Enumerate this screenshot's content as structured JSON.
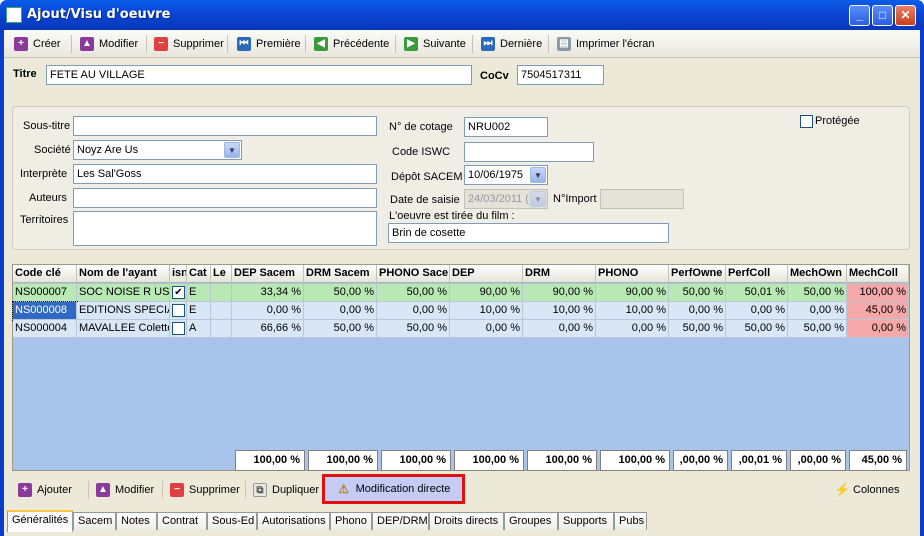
{
  "window": {
    "title": "Ajout/Visu d'oeuvre"
  },
  "toolbar": {
    "create": "Créer",
    "modify": "Modifier",
    "delete": "Supprimer",
    "first": "Première",
    "previous": "Précédente",
    "next": "Suivante",
    "last": "Dernière",
    "print": "Imprimer l'écran"
  },
  "header": {
    "title_label": "Titre",
    "title_value": "FETE AU VILLAGE",
    "cocv_label": "CoCv",
    "cocv_value": "7504517311"
  },
  "form": {
    "subtitle_label": "Sous-titre",
    "subtitle_value": "",
    "company_label": "Société",
    "company_value": "Noyz Are Us",
    "performer_label": "Interprète",
    "performer_value": "Les Sal'Goss",
    "authors_label": "Auteurs",
    "authors_value": "",
    "territories_label": "Territoires",
    "territories_value": "",
    "cotage_label": "N° de cotage",
    "cotage_value": "NRU002",
    "iswc_label": "Code ISWC",
    "iswc_value": "",
    "sacem_label": "Dépôt SACEM",
    "sacem_value": "10/06/1975",
    "entry_date_label": "Date de saisie",
    "entry_date_value": "24/03/2011 (",
    "import_label": "N°Import",
    "import_value": "",
    "film_label": "L'oeuvre est tirée du film :",
    "film_value": "Brin de cosette",
    "protected_label": "Protégée"
  },
  "grid": {
    "columns": [
      "Code clé",
      "Nom de l'ayant",
      "isn",
      "Cat",
      "Le",
      "DEP Sacem",
      "DRM Sacem",
      "PHONO Sace",
      "DEP",
      "DRM",
      "PHONO",
      "PerfOwne",
      "PerfColl",
      "MechOwn",
      "MechColl"
    ],
    "rows": [
      {
        "code": "NS000007",
        "name": "SOC NOISE R US",
        "isn": true,
        "cat": "E",
        "le": "",
        "v": [
          "33,34 %",
          "50,00 %",
          "50,00 %",
          "90,00 %",
          "90,00 %",
          "90,00 %",
          "50,00 %",
          "50,01 %",
          "50,00 %",
          "100,00 %"
        ]
      },
      {
        "code": "NS000008",
        "name": "EDITIONS SPECIA",
        "isn": false,
        "cat": "E",
        "le": "",
        "v": [
          "0,00 %",
          "0,00 %",
          "0,00 %",
          "10,00 %",
          "10,00 %",
          "10,00 %",
          "0,00 %",
          "0,00 %",
          "0,00 %",
          "45,00 %"
        ]
      },
      {
        "code": "NS000004",
        "name": "MAVALLEE Colette",
        "isn": false,
        "cat": "A",
        "le": "",
        "v": [
          "66,66 %",
          "50,00 %",
          "50,00 %",
          "0,00 %",
          "0,00 %",
          "0,00 %",
          "50,00 %",
          "50,00 %",
          "50,00 %",
          "0,00 %"
        ]
      }
    ],
    "totals": [
      "100,00 %",
      "100,00 %",
      "100,00 %",
      "100,00 %",
      "100,00 %",
      "100,00 %",
      ",00,00 %",
      ",00,01 %",
      ",00,00 %",
      "45,00 %"
    ]
  },
  "bottom": {
    "add": "Ajouter",
    "modify": "Modifier",
    "delete": "Supprimer",
    "duplicate": "Dupliquer",
    "direct": "Modification directe",
    "columns": "Colonnes"
  },
  "tabs": [
    "Généralités",
    "Sacem",
    "Notes",
    "Contrat",
    "Sous-Ed",
    "Autorisations",
    "Phono",
    "DEP/DRM",
    "Droits directs",
    "Groupes",
    "Supports",
    "Pubs"
  ],
  "colors": {
    "row_green": "#b8e8b4",
    "row_blue": "#d8e6f6",
    "mech_red": "#f5a8a8",
    "grid_bg": "#a8c4ea",
    "highlight_border": "#e01010"
  }
}
